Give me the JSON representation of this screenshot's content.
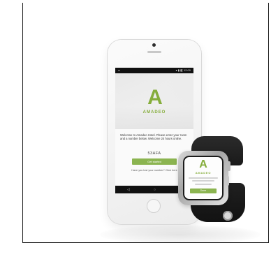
{
  "app": {
    "brand_mark": "A",
    "brand_name": "AMADEO"
  },
  "phone": {
    "status": {
      "left": "◂",
      "right": "▾ ▮ ◧ 12:00"
    },
    "welcome_text": "Welcome to Amadeo Hotel. Please enter your room and a number below. Welcome 24 hours online.",
    "code_value": "53AFA",
    "button_label": "Get started",
    "help_text": "Have you lost your number? Click here"
  },
  "watch": {
    "brand_mark": "A",
    "brand_name": "AMADEO",
    "button_label": "Done"
  },
  "colors": {
    "brand_green": "#85ad3b",
    "button_green": "#8bb450",
    "band_black": "#1a1a1a"
  },
  "icons": {
    "nav_back": "back-triangle-icon",
    "nav_home": "home-circle-icon",
    "nav_recent": "recent-square-icon"
  }
}
